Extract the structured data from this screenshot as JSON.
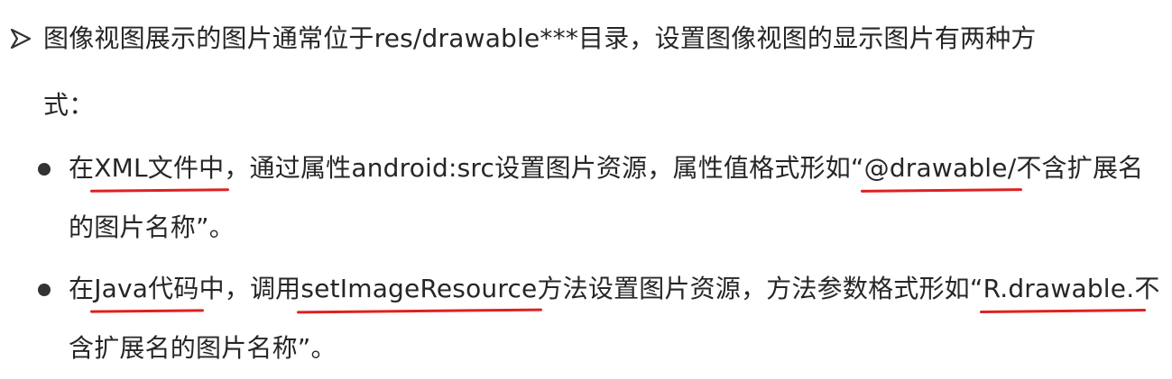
{
  "intro": {
    "line1": "图像视图展示的图片通常位于res/drawable***目录，设置图像视图的显示图片有两种方",
    "line2": "式："
  },
  "items": [
    {
      "l1_pre": "在",
      "l1_u1": "XML文件中",
      "l1_mid": "，通过属性android:src设置图片资源，属性值格式形如“",
      "l1_u2": "@drawable/",
      "l1_post": "不含扩展名",
      "l2": "的图片名称”。"
    },
    {
      "l1_pre": "在",
      "l1_u1": "Java代码",
      "l1_mid1": "中，调用",
      "l1_u2": "setImageResource",
      "l1_mid2": "方法设置图片资源，方法参数格式形如“",
      "l1_u3": "R.drawable.",
      "l1_post": "不",
      "l2": "含扩展名的图片名称”。"
    }
  ],
  "colors": {
    "text": "#262626",
    "underline": "#e02020",
    "bullet": "#333333"
  }
}
